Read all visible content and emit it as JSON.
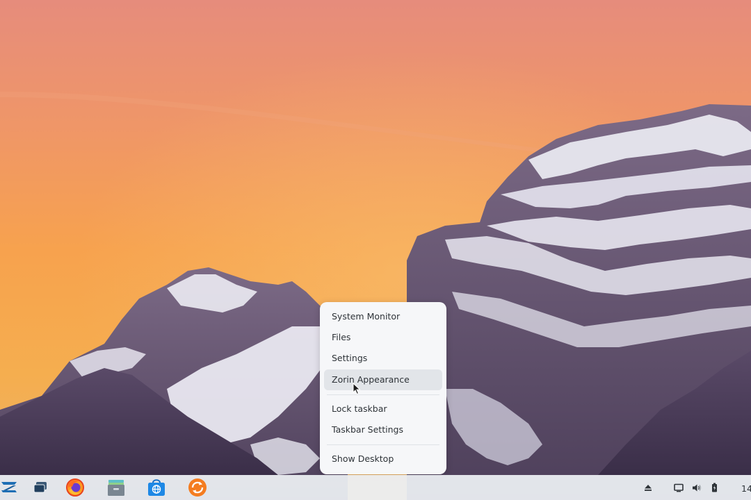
{
  "context_menu": {
    "items": [
      {
        "label": "System Monitor"
      },
      {
        "label": "Files"
      },
      {
        "label": "Settings"
      },
      {
        "label": "Zorin Appearance"
      },
      {
        "label": "Lock taskbar"
      },
      {
        "label": "Taskbar Settings"
      },
      {
        "label": "Show Desktop"
      }
    ],
    "highlighted_item": "Zorin Appearance"
  },
  "taskbar": {
    "launchers": [
      {
        "icon": "zorin-menu-icon"
      },
      {
        "icon": "workspaces-icon"
      },
      {
        "icon": "firefox-icon"
      },
      {
        "icon": "files-icon"
      },
      {
        "icon": "software-store-icon"
      },
      {
        "icon": "software-updater-icon"
      }
    ],
    "tray": [
      {
        "icon": "eject-icon"
      },
      {
        "icon": "display-icon"
      },
      {
        "icon": "volume-icon"
      },
      {
        "icon": "battery-icon"
      }
    ],
    "clock": "14"
  },
  "colors": {
    "sky_top": "#e98f7a",
    "sky_mid": "#f6a14f",
    "menu_bg": "#f6f7f9",
    "menu_highlight": "#e2e5e9",
    "taskbar_bg": "#eceff3",
    "accent_blue": "#1e88e5",
    "updater_orange": "#f47c20"
  }
}
